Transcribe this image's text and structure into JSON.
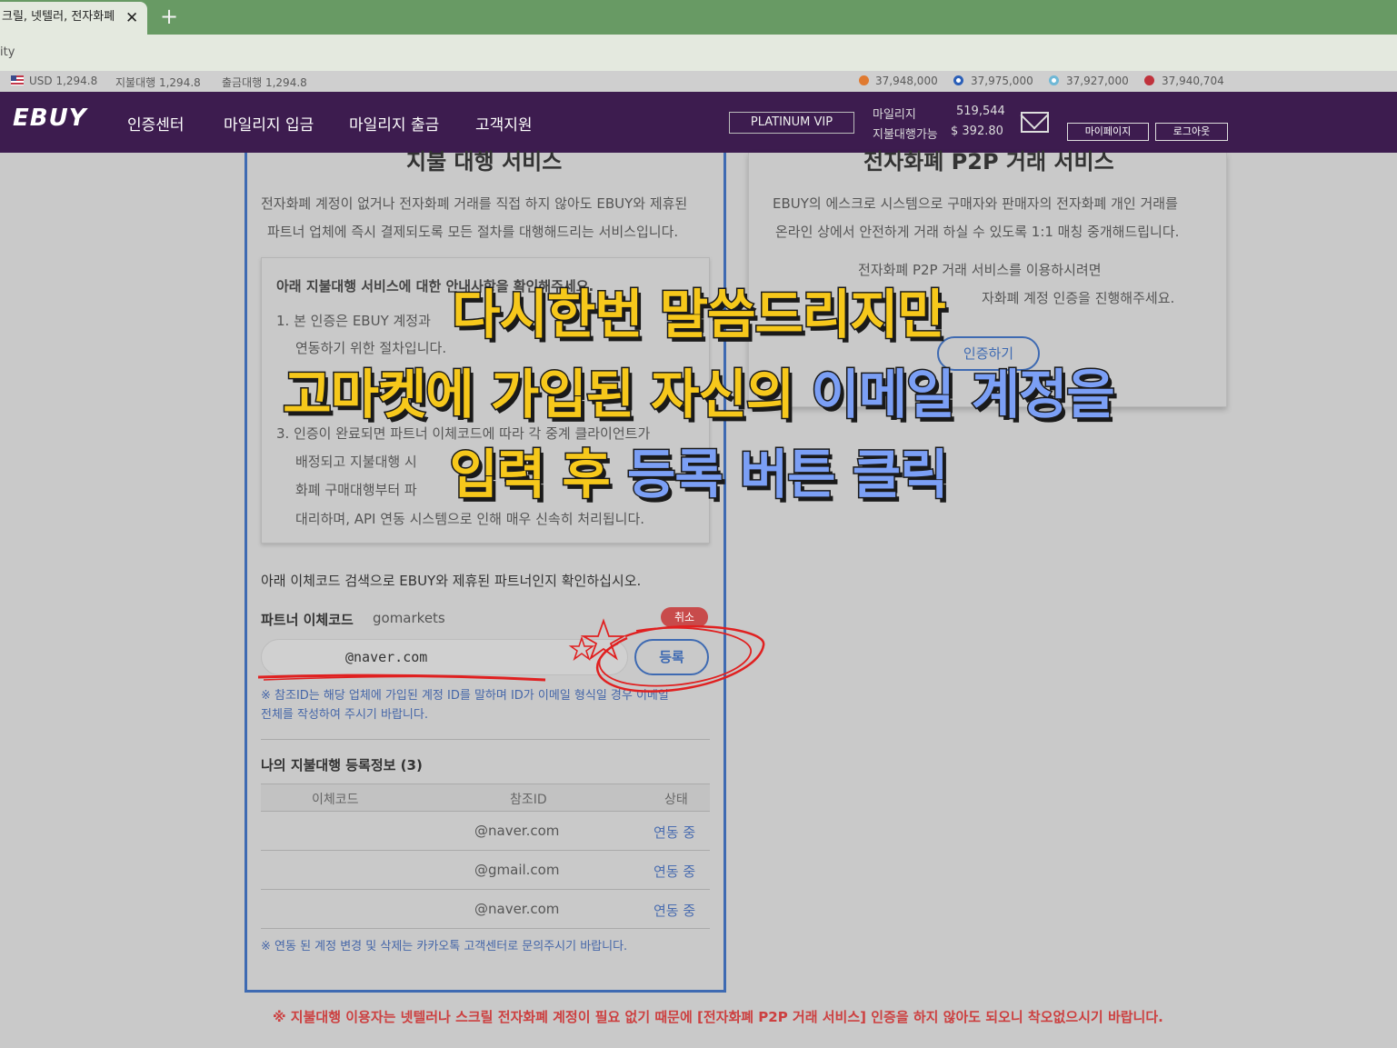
{
  "browser": {
    "tab_title": "크릴, 넷텔러, 전자화폐",
    "address_text": "ity"
  },
  "infobar": {
    "usd": "USD 1,294.8",
    "pay_rate": "지불대행 1,294.8",
    "withdraw_rate": "출금대행 1,294.8",
    "coins": [
      "37,948,000",
      "37,975,000",
      "37,927,000",
      "37,940,704"
    ]
  },
  "header": {
    "logo": "EBUY",
    "nav": [
      "인증센터",
      "마일리지 입금",
      "마일리지 출금",
      "고객지원"
    ],
    "vip": "PLATINUM VIP",
    "mileage_label": "마일리지",
    "mileage_value": "519,544",
    "pay_label": "지불대행가능",
    "pay_value": "$ 392.80",
    "mypage": "마이페이지",
    "logout": "로그아웃"
  },
  "left": {
    "title": "지불 대행 서비스",
    "desc1": "전자화폐 계정이 없거나 전자화폐 거래를 직접 하지 않아도 EBUY와 제휴된",
    "desc2": "파트너 업체에 즉시 결제되도록 모든 절차를 대행해드리는 서비스입니다.",
    "notice_title": "아래 지불대행 서비스에 대한 안내사항을 확인해주세요.",
    "notice_lines": [
      "1. 본 인증은 EBUY 계정과",
      "연동하기 위한 절차입니다.",
      "3. 인증이 완료되면 파트너 이체코드에 따라 각 중계 클라이언트가",
      "배정되고 지불대행 시",
      "화폐 구매대행부터 파",
      "대리하며, API 연동 시스템으로 인해 매우 신속히 처리됩니다."
    ],
    "search_info": "아래 이체코드 검색으로 EBUY와 제휴된 파트너인지 확인하십시오.",
    "partner_label": "파트너 이체코드",
    "partner_value": "gomarkets",
    "cancel": "취소",
    "email_value": "@naver.com",
    "register": "등록",
    "note1": "※ 참조ID는 해당 업체에 가입된 계정 ID를 말하며 ID가 이메일 형식일 경우 이메일",
    "note2": "전체를 작성하여 주시기 바랍니다.",
    "my_reg_title": "나의 지불대행 등록정보 (3)",
    "table_headers": [
      "이체코드",
      "참조ID",
      "상태"
    ],
    "rows": [
      {
        "code": "",
        "ref": "@naver.com",
        "status": "연동 중"
      },
      {
        "code": "",
        "ref": "@gmail.com",
        "status": "연동 중"
      },
      {
        "code": "",
        "ref": "@naver.com",
        "status": "연동 중"
      }
    ],
    "footer_note": "※ 연동 된 계정 변경 및 삭제는 카카오톡 고객센터로 문의주시기 바랍니다."
  },
  "right": {
    "title": "전자화폐 P2P 거래 서비스",
    "desc1": "EBUY의 에스크로 시스템으로 구매자와 판매자의 전자화폐 개인 거래를",
    "desc2": "온라인 상에서 안전하게 거래 하실 수 있도록 1:1 매칭 중개해드립니다.",
    "desc3": "전자화폐 P2P 거래 서비스를 이용하시려면",
    "desc4": "자화폐 계정 인증을 진행해주세요.",
    "cert_button": "인증하기"
  },
  "bottom_note": "※ 지불대행 이용자는 넷텔러나 스크릴 전자화폐 계정이 필요 없기 때문에 [전자화폐 P2P 거래 서비스] 인증을 하지 않아도 되오니 착오없으시기 바랍니다.",
  "overlay": {
    "line1": "다시한번 말씀드리지만",
    "line2a": "고마켓에 가입된 자신의",
    "line2b": "이메일 계정을",
    "line3a": "입력 후",
    "line3b": "등록 버튼 클릭"
  },
  "colors": {
    "header_bg": "#3d1c4f",
    "accent_blue": "#3e6ab2",
    "overlay_yellow": "#f6c81b",
    "overlay_blue": "#7b9ff5",
    "annotation_red": "#e02020"
  }
}
